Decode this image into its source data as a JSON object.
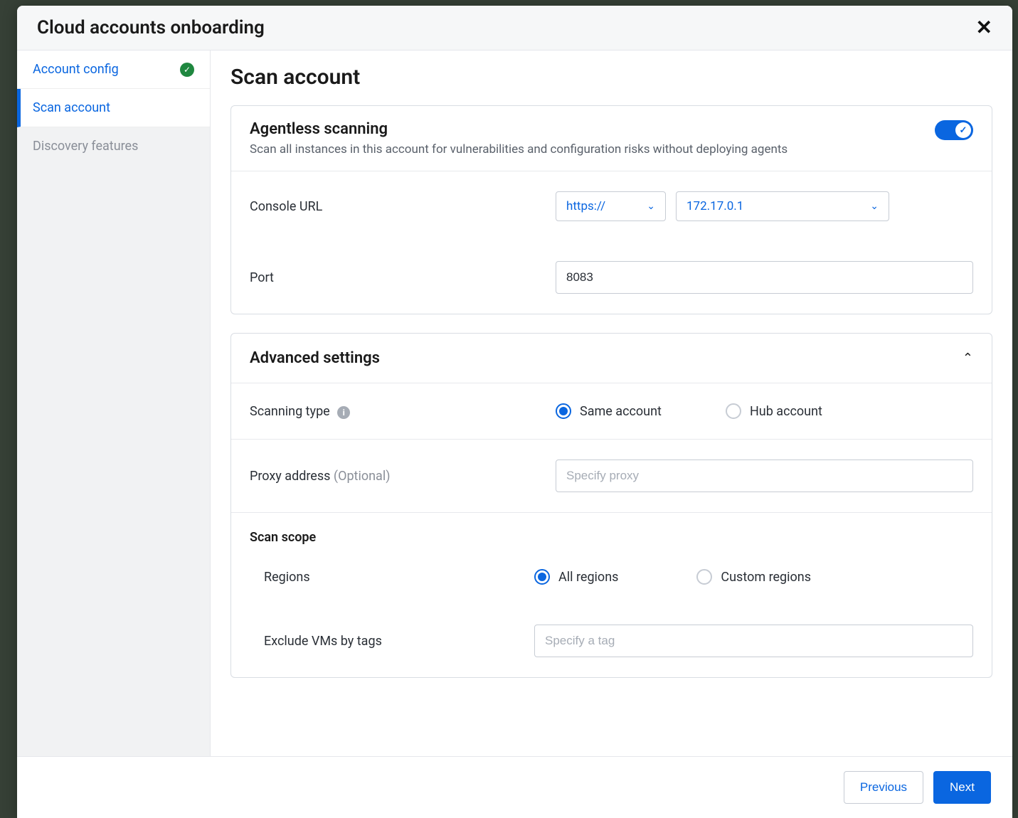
{
  "modal": {
    "title": "Cloud accounts onboarding"
  },
  "sidebar": {
    "items": [
      {
        "label": "Account config",
        "state": "done"
      },
      {
        "label": "Scan account",
        "state": "active"
      },
      {
        "label": "Discovery features",
        "state": "pending"
      }
    ]
  },
  "page": {
    "heading": "Scan account"
  },
  "agentless": {
    "title": "Agentless scanning",
    "description": "Scan all instances in this account for vulnerabilities and configuration risks without deploying agents",
    "toggle_on": true,
    "console_url": {
      "label": "Console URL",
      "protocol": "https://",
      "host": "172.17.0.1"
    },
    "port": {
      "label": "Port",
      "value": "8083"
    }
  },
  "advanced": {
    "title": "Advanced settings",
    "expanded": true,
    "scanning_type": {
      "label": "Scanning type",
      "options": [
        "Same account",
        "Hub account"
      ],
      "selected": "Same account"
    },
    "proxy": {
      "label": "Proxy address",
      "optional_tag": "(Optional)",
      "placeholder": "Specify proxy",
      "value": ""
    },
    "scan_scope": {
      "title": "Scan scope",
      "regions": {
        "label": "Regions",
        "options": [
          "All regions",
          "Custom regions"
        ],
        "selected": "All regions"
      },
      "exclude_tags": {
        "label": "Exclude VMs by tags",
        "placeholder": "Specify a tag",
        "value": ""
      }
    }
  },
  "footer": {
    "previous": "Previous",
    "next": "Next"
  }
}
